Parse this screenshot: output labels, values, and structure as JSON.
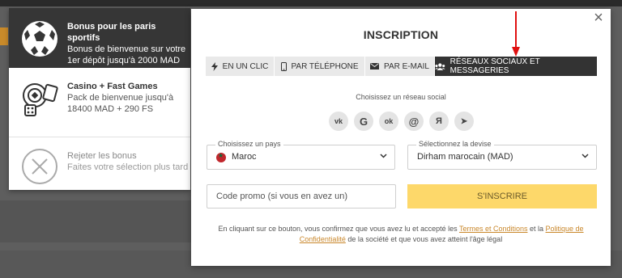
{
  "bonus_panel": {
    "items": [
      {
        "title": "Bonus pour les paris sportifs",
        "desc": "Bonus de bienvenue sur votre 1er dépôt jusqu'à 2000 MAD",
        "icon": "soccer-ball-icon"
      },
      {
        "title": "Casino + Fast Games",
        "desc": "Pack de bienvenue jusqu'à 18400 MAD + 290 FS",
        "icon": "casino-chips-icon"
      },
      {
        "title": "Rejeter les bonus",
        "desc": "Faites votre sélection plus tard",
        "icon": "close-circle-icon"
      }
    ]
  },
  "modal": {
    "title": "INSCRIPTION",
    "close_label": "×",
    "tabs": [
      {
        "label": "EN UN CLIC",
        "icon": "lightning-icon"
      },
      {
        "label": "PAR TÉLÉPHONE",
        "icon": "phone-icon"
      },
      {
        "label": "PAR E-MAIL",
        "icon": "envelope-icon"
      },
      {
        "label": "RÉSEAUX SOCIAUX ET MESSAGERIES",
        "icon": "users-icon"
      }
    ],
    "social_label": "Choisissez un réseau social",
    "socials": [
      {
        "glyph": "vk",
        "icon": "vk-icon"
      },
      {
        "glyph": "G",
        "icon": "google-icon"
      },
      {
        "glyph": "ok",
        "icon": "odnoklassniki-icon"
      },
      {
        "glyph": "@",
        "icon": "mail-ru-icon"
      },
      {
        "glyph": "Я",
        "icon": "yandex-icon"
      },
      {
        "glyph": "➤",
        "icon": "telegram-icon"
      }
    ],
    "country": {
      "label": "Choisissez un pays",
      "value": "Maroc"
    },
    "currency": {
      "label": "Sélectionnez la devise",
      "value": "Dirham marocain (MAD)"
    },
    "promo": {
      "placeholder": "Code promo (si vous en avez un)"
    },
    "submit_label": "S'INSCRIRE",
    "terms": {
      "before": "En cliquant sur ce bouton, vous confirmez que vous avez lu et accepté les ",
      "link1": "Termes et Conditions",
      "middle": " et la ",
      "link2": "Politique de Confidentialité",
      "after": " de la société et que vous avez atteint l'âge légal"
    }
  },
  "colors": {
    "accent_yellow": "#fdd86a",
    "dark": "#333333",
    "link": "#c9872b",
    "annotation_red": "#e01010"
  }
}
